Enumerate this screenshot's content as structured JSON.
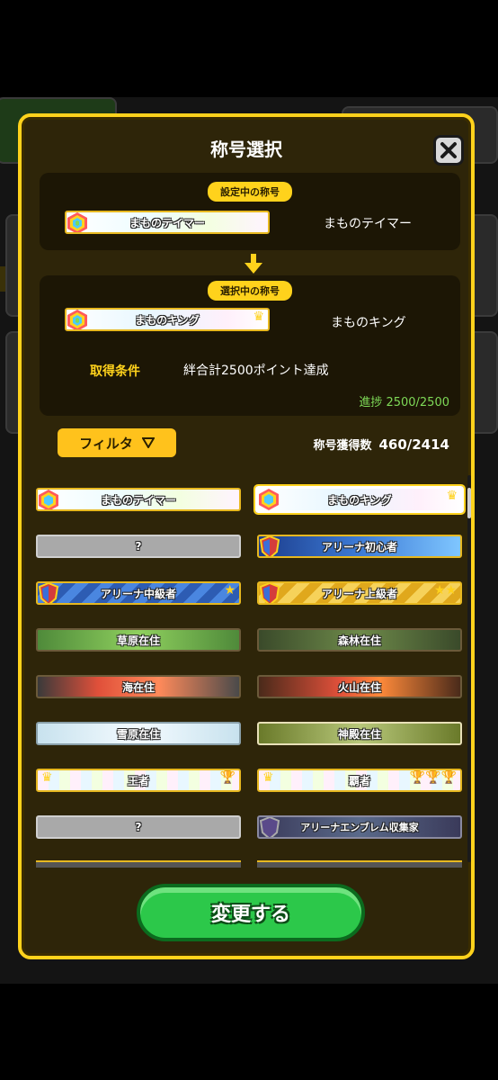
{
  "dialog": {
    "title": "称号選択",
    "current_label": "設定中の称号",
    "current_plate_text": "まものテイマー",
    "current_name": "まものテイマー",
    "selected_label": "選択中の称号",
    "selected_plate_text": "まものキング",
    "selected_name": "まものキング",
    "condition_label": "取得条件",
    "condition_text": "絆合計2500ポイント達成",
    "progress_text": "進捗 2500/2500",
    "filter_label": "フィルタ",
    "count_label": "称号獲得数",
    "count_value": "460/2414",
    "change_button": "変更する"
  },
  "titles": [
    {
      "text": "まものテイマー",
      "style": "rainbow"
    },
    {
      "text": "まものキング",
      "style": "rainbow-selected"
    },
    {
      "text": "?",
      "style": "locked"
    },
    {
      "text": "アリーナ初心者",
      "style": "arena-beginner"
    },
    {
      "text": "アリーナ中級者",
      "style": "arena-mid"
    },
    {
      "text": "アリーナ上級者",
      "style": "arena-high"
    },
    {
      "text": "草原在住",
      "style": "grass"
    },
    {
      "text": "森林在住",
      "style": "forest"
    },
    {
      "text": "海在住",
      "style": "sea"
    },
    {
      "text": "火山在住",
      "style": "volcano"
    },
    {
      "text": "雪原在住",
      "style": "snow"
    },
    {
      "text": "神殿在住",
      "style": "temple"
    },
    {
      "text": "王者",
      "style": "king"
    },
    {
      "text": "覇者",
      "style": "champion"
    },
    {
      "text": "?",
      "style": "locked"
    },
    {
      "text": "アリーナエンブレム収集家",
      "style": "collector"
    }
  ],
  "colors": {
    "accent": "#ffd21c",
    "progress": "#7ed957",
    "button_green": "#2cc84a"
  }
}
